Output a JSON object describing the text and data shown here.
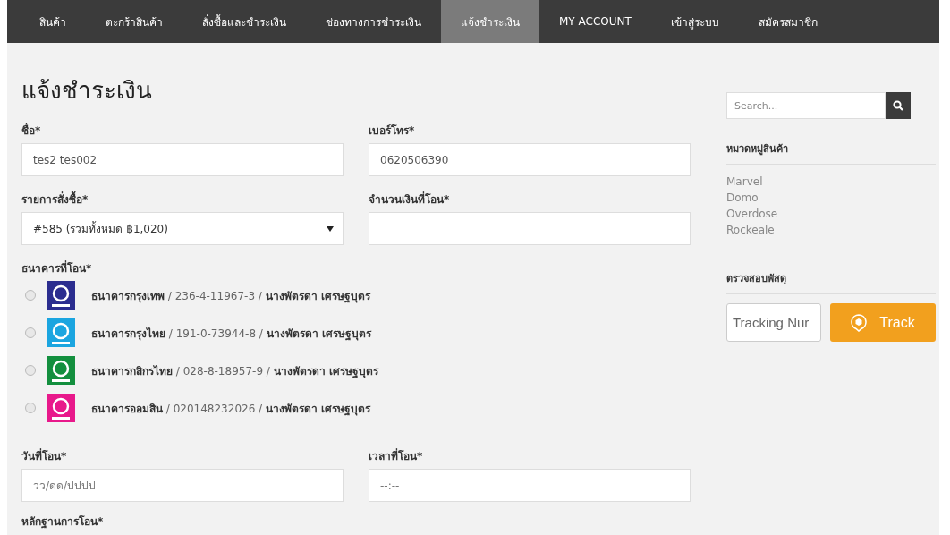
{
  "nav": [
    {
      "label": "สินค้า",
      "selected": false
    },
    {
      "label": "ตะกร้าสินค้า",
      "selected": false
    },
    {
      "label": "สั่งซื้อและชำระเงิน",
      "selected": false
    },
    {
      "label": "ช่องทางการชำระเงิน",
      "selected": false
    },
    {
      "label": "แจ้งชำระเงิน",
      "selected": true
    },
    {
      "label": "MY ACCOUNT",
      "selected": false
    },
    {
      "label": "เข้าสู่ระบบ",
      "selected": false
    },
    {
      "label": "สมัครสมาชิก",
      "selected": false
    }
  ],
  "form": {
    "title": "แจ้งชำระเงิน",
    "name": {
      "label": "ชื่อ*",
      "value": "tes2 tes002"
    },
    "phone": {
      "label": "เบอร์โทร*",
      "value": "0620506390"
    },
    "order": {
      "label": "รายการสั่งซื้อ*",
      "value": "#585 (รวมทั้งหมด ฿1,020)"
    },
    "amount": {
      "label": "จำนวนเงินที่โอน*"
    },
    "bank": {
      "label": "ธนาคารที่โอน*",
      "options": [
        {
          "text": "**ธนาคารกรุงเทพ** / 236-4-11967-3 / **นางพัตรดา เศรษฐบุตร**",
          "selected": false,
          "color": "#2b2d8f"
        },
        {
          "text": "**ธนาคารกรุงไทย** / 191-0-73944-8 / **นางพัตรดา เศรษฐบุตร**",
          "selected": false,
          "color": "#1ba5e0"
        },
        {
          "text": "**ธนาคารกสิกรไทย** / 028-8-18957-9 / **นางพัตรดา เศรษฐบุตร**",
          "selected": false,
          "color": "#138f3e"
        },
        {
          "text": "**ธนาคารออมสิน** / 020148232026 / **นางพัตรดา เศรษฐบุตร**",
          "selected": false,
          "color": "#e8198b"
        }
      ]
    },
    "date": {
      "label": "วันที่โอน*",
      "placeholder": "วว/ดด/ปปปป"
    },
    "time": {
      "label": "เวลาที่โอน*",
      "placeholder": "--:--"
    },
    "proof": {
      "label": "หลักฐานการโอน*"
    }
  },
  "sidebar": {
    "search": {
      "placeholder": "Search..."
    },
    "categories": {
      "title": "หมวดหมู่สินค้า",
      "items": [
        "Marvel",
        "Domo",
        "Overdose",
        "Rockeale"
      ]
    },
    "tracking": {
      "title": "ตรวจสอบพัสดุ",
      "placeholder": "Tracking Nur",
      "button": "Track"
    }
  }
}
